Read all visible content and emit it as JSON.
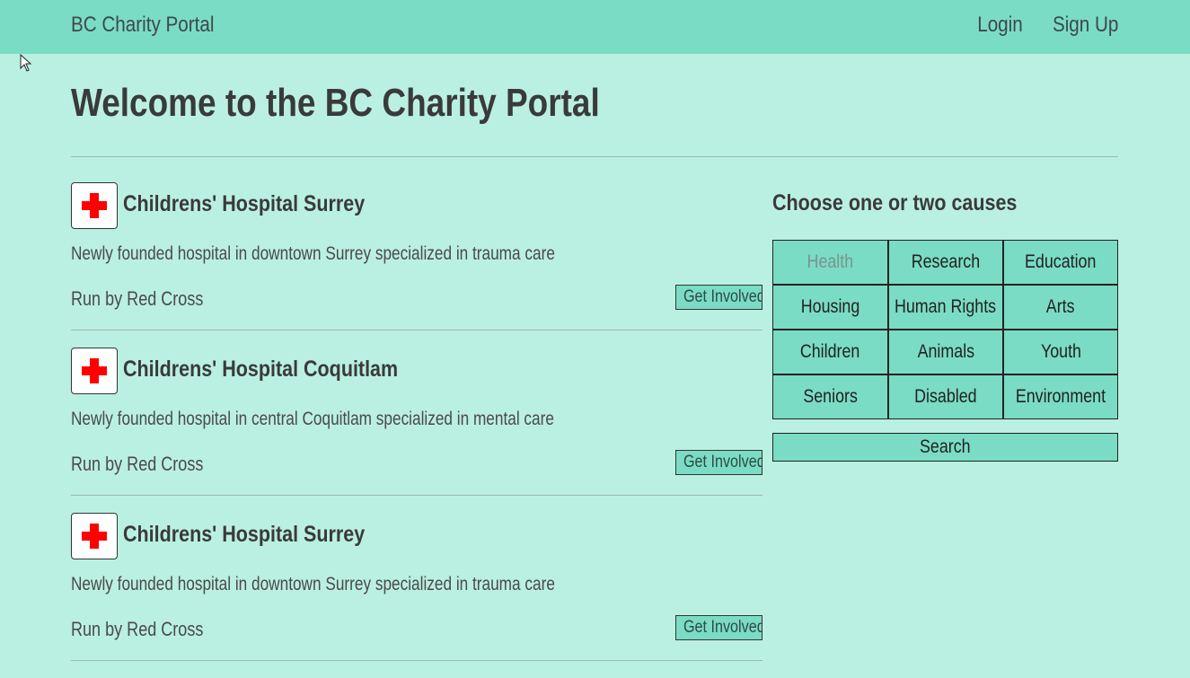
{
  "navbar": {
    "brand": "BC Charity Portal",
    "login": "Login",
    "signup": "Sign Up"
  },
  "page_title": "Welcome to the BC Charity Portal",
  "listings": [
    {
      "name": "Childrens' Hospital Surrey",
      "description": "Newly founded hospital in downtown Surrey specialized in trauma care",
      "run_by": "Run by Red Cross",
      "button": "Get Involved",
      "icon": "red-cross-icon"
    },
    {
      "name": "Childrens' Hospital Coquitlam",
      "description": "Newly founded hospital in central Coquitlam specialized in mental care",
      "run_by": "Run by Red Cross",
      "button": "Get Involved",
      "icon": "red-cross-icon"
    },
    {
      "name": "Childrens' Hospital Surrey",
      "description": "Newly founded hospital in downtown Surrey specialized in trauma care",
      "run_by": "Run by Red Cross",
      "button": "Get Involved",
      "icon": "red-cross-icon"
    }
  ],
  "causes": {
    "title": "Choose one or two causes",
    "options": [
      "Health",
      "Research",
      "Education",
      "Housing",
      "Human Rights",
      "Arts",
      "Children",
      "Animals",
      "Youth",
      "Seniors",
      "Disabled",
      "Environment"
    ],
    "selected": "Health",
    "search_label": "Search"
  },
  "colors": {
    "background": "#baf0e1",
    "navbar": "#7adcc4",
    "button": "#7adcc4",
    "cross": "#ff0000",
    "text": "#3a3a3a"
  }
}
